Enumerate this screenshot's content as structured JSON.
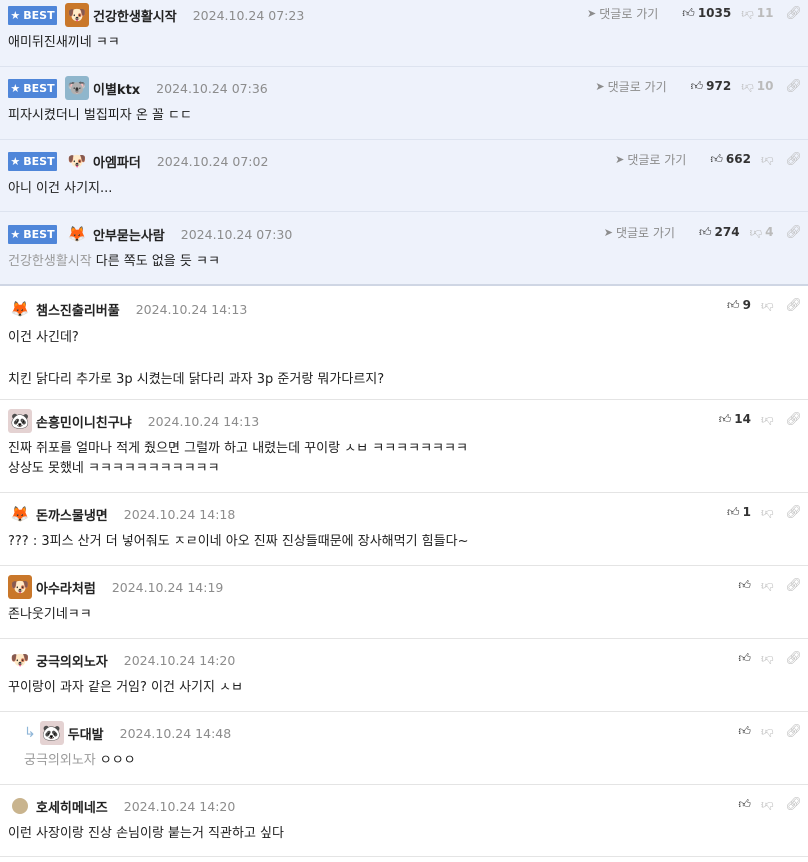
{
  "labels": {
    "best": "BEST",
    "goto": "댓글로 가기"
  },
  "comments": [
    {
      "id": 0,
      "best": true,
      "avatar": "dog-avatar",
      "nick": "건강한생활시작",
      "date": "2024.10.24 07:23",
      "up": "1035",
      "down": "11",
      "text": "애미뒤진새끼네 ㅋㅋ",
      "mention": ""
    },
    {
      "id": 1,
      "best": true,
      "avatar": "koala-avatar",
      "nick": "이별ktx",
      "date": "2024.10.24 07:36",
      "up": "972",
      "down": "10",
      "text": "피자시켰더니 벌집피자 온 꼴 ㄷㄷ",
      "mention": ""
    },
    {
      "id": 2,
      "best": true,
      "avatar": "puppy-avatar",
      "nick": "아엠파더",
      "date": "2024.10.24 07:02",
      "up": "662",
      "down": "",
      "text": "아니 이건 사기지...",
      "mention": ""
    },
    {
      "id": 3,
      "best": true,
      "avatar": "fox-avatar",
      "nick": "안부묻는사람",
      "date": "2024.10.24 07:30",
      "up": "274",
      "down": "4",
      "text": "다른 쪽도 없을 듯 ㅋㅋ",
      "mention": "건강한생활시작"
    },
    {
      "id": 4,
      "best": false,
      "avatar": "fox-avatar",
      "nick": "챔스진출리버풀",
      "date": "2024.10.24 14:13",
      "up": "9",
      "down": "",
      "lines": [
        "이건 사긴데?",
        "",
        "치킨 닭다리 추가로 3p 시켰는데 닭다리 과자 3p 준거랑 뭐가다르지?"
      ]
    },
    {
      "id": 5,
      "best": false,
      "avatar": "panda-avatar",
      "nick": "손흥민이니친구냐",
      "date": "2024.10.24 14:13",
      "up": "14",
      "down": "",
      "lines": [
        "진짜 쥐포를 얼마나 적게 줬으면 그럴까 하고 내렸는데 꾸이랑 ㅅㅂ ㅋㅋㅋㅋㅋㅋㅋㅋ",
        "상상도 못했네 ㅋㅋㅋㅋㅋㅋㅋㅋㅋㅋㅋ"
      ]
    },
    {
      "id": 6,
      "best": false,
      "avatar": "fox-avatar",
      "nick": "돈까스물냉면",
      "date": "2024.10.24 14:18",
      "up": "1",
      "down": "",
      "lines": [
        "??? : 3피스 산거 더 넣어줘도 ㅈㄹ이네 아오 진짜 진상들때문에 장사해먹기 힘들다~"
      ]
    },
    {
      "id": 7,
      "best": false,
      "avatar": "dog-avatar",
      "nick": "아수라처럼",
      "date": "2024.10.24 14:19",
      "up": "",
      "down": "",
      "lines": [
        "존나웃기네ㅋㅋ"
      ]
    },
    {
      "id": 8,
      "best": false,
      "avatar": "puppy-avatar",
      "nick": "궁극의외노자",
      "date": "2024.10.24 14:20",
      "up": "",
      "down": "",
      "lines": [
        "꾸이랑이 과자 같은 거임? 이건 사기지 ㅅㅂ"
      ]
    },
    {
      "id": 9,
      "best": false,
      "reply": true,
      "avatar": "panda-avatar",
      "nick": "두대발",
      "date": "2024.10.24 14:48",
      "up": "",
      "down": "",
      "mention": "궁극의외노자",
      "text": "ㅇㅇㅇ"
    },
    {
      "id": 10,
      "best": false,
      "avatar": "ball-avatar",
      "nick": "호세히메네즈",
      "date": "2024.10.24 14:20",
      "up": "",
      "down": "",
      "lines": [
        "이런 사장이랑 진상 손님이랑 붙는거 직관하고 싶다"
      ]
    }
  ]
}
